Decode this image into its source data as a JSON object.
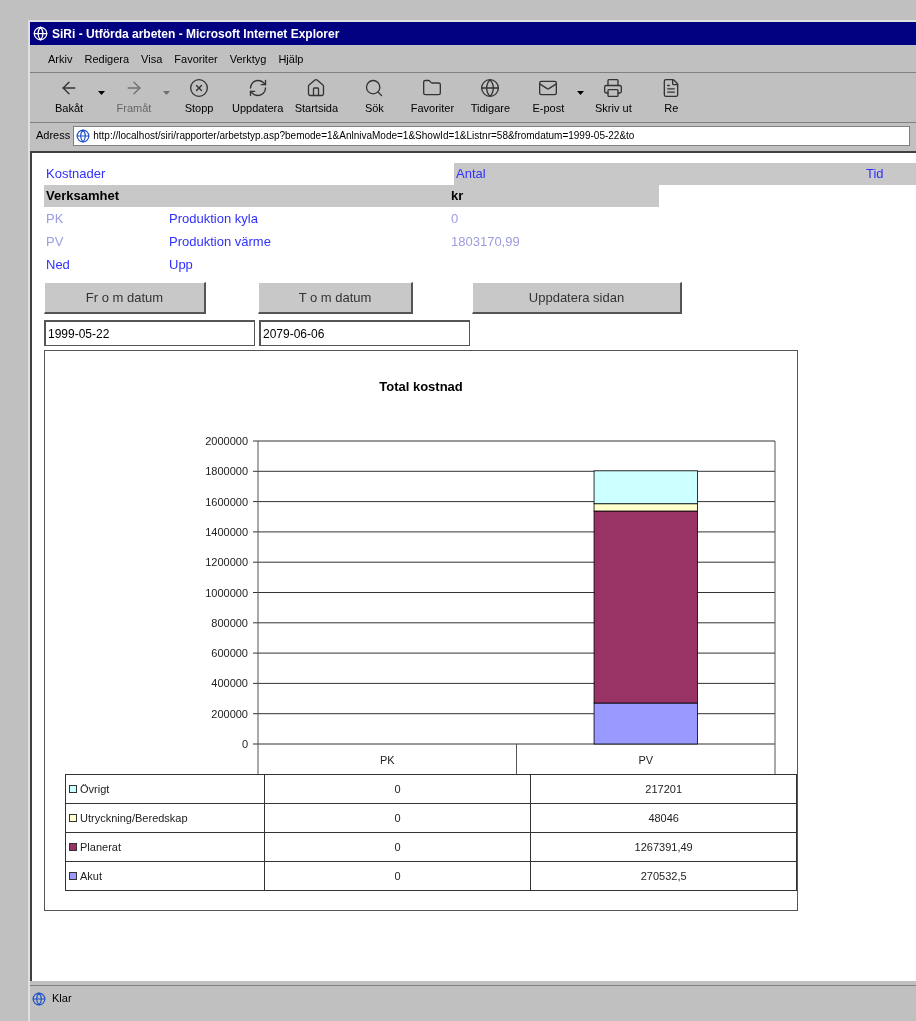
{
  "window": {
    "title": "SiRi - Utförda arbeten - Microsoft Internet Explorer"
  },
  "menu": [
    "Arkiv",
    "Redigera",
    "Visa",
    "Favoriter",
    "Verktyg",
    "Hjälp"
  ],
  "toolbar": [
    {
      "kind": "back",
      "label": "Bakåt",
      "disabled": false,
      "dropdown": true
    },
    {
      "kind": "forward",
      "label": "Framåt",
      "disabled": true,
      "dropdown": true
    },
    {
      "kind": "stop",
      "label": "Stopp",
      "disabled": false
    },
    {
      "kind": "refresh",
      "label": "Uppdatera",
      "disabled": false
    },
    {
      "kind": "home",
      "label": "Startsida",
      "disabled": false
    },
    {
      "kind": "search",
      "label": "Sök",
      "disabled": false
    },
    {
      "kind": "favorites",
      "label": "Favoriter",
      "disabled": false
    },
    {
      "kind": "history",
      "label": "Tidigare",
      "disabled": false
    },
    {
      "kind": "mail",
      "label": "E-post",
      "disabled": false,
      "dropdown": true
    },
    {
      "kind": "print",
      "label": "Skriv ut",
      "disabled": false
    },
    {
      "kind": "edit",
      "label": "Re",
      "disabled": false
    }
  ],
  "address": {
    "label": "Adress",
    "value": "http://localhost/siri/rapporter/arbetstyp.asp?bemode=1&AnlnivaMode=1&ShowId=1&Listnr=58&fromdatum=1999-05-22&to"
  },
  "tabs": [
    {
      "label": "Kostnader",
      "selected": true
    },
    {
      "label": "Antal",
      "selected": false
    },
    {
      "label": "Tid",
      "selected": false
    }
  ],
  "table": {
    "columns": [
      "Verksamhet",
      "kr"
    ],
    "rows": [
      {
        "code": "PK",
        "name": "Produktion kyla",
        "value": "0"
      },
      {
        "code": "PV",
        "name": "Produktion värme",
        "value": "1803170,99"
      }
    ]
  },
  "sort_links": [
    "Ned",
    "Upp"
  ],
  "buttons": [
    "Fr o m datum",
    "T o m datum",
    "Uppdatera sidan"
  ],
  "date_fields": [
    "1999-05-22",
    "2079-06-06"
  ],
  "chart": {
    "chart_data": {
      "type": "bar",
      "title": "Total kostnad",
      "stacked": true,
      "categories": [
        "PK",
        "PV"
      ],
      "series": [
        {
          "name": "Akut",
          "color": "#9999ff",
          "values": [
            0,
            270532.5
          ]
        },
        {
          "name": "Planerat",
          "color": "#993366",
          "values": [
            0,
            1267391.49
          ]
        },
        {
          "name": "Utryckning/Beredskap",
          "color": "#ffffcc",
          "values": [
            0,
            48046
          ]
        },
        {
          "name": "Övrigt",
          "color": "#ccffff",
          "values": [
            0,
            217201
          ]
        }
      ],
      "grid": true,
      "legend": true,
      "ylim": [
        0,
        2000000
      ],
      "yticks": [
        0,
        200000,
        400000,
        600000,
        800000,
        1000000,
        1200000,
        1400000,
        1600000,
        1800000,
        2000000
      ]
    },
    "data_table": [
      {
        "cells": [
          "0",
          "217201"
        ]
      },
      {
        "cells": [
          "0",
          "48046"
        ]
      },
      {
        "cells": [
          "0",
          "1267391,49"
        ]
      },
      {
        "cells": [
          "0",
          "270532,5"
        ]
      }
    ]
  },
  "status_bar": {
    "text": "Klar"
  }
}
